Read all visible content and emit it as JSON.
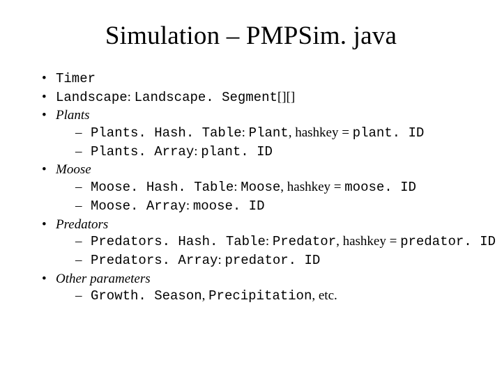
{
  "title": "Simulation – PMPSim. java",
  "bullets": {
    "b1": {
      "timer": "Timer"
    },
    "b2": {
      "landscape": "Landscape",
      "sep": ": ",
      "seg": "Landscape. Segment",
      "suffix": "[][]"
    },
    "b3": {
      "label": "Plants",
      "s1": {
        "a": "Plants. Hash. Table",
        "sep1": ": ",
        "b": "Plant",
        "mid": ", hashkey = ",
        "c": "plant. ID"
      },
      "s2": {
        "a": "Plants. Array",
        "sep1": ": ",
        "b": "plant. ID"
      }
    },
    "b4": {
      "label": "Moose",
      "s1": {
        "a": "Moose. Hash. Table",
        "sep1": ": ",
        "b": "Moose",
        "mid": ", hashkey = ",
        "c": "moose. ID"
      },
      "s2": {
        "a": "Moose. Array",
        "sep1": ": ",
        "b": "moose. ID"
      }
    },
    "b5": {
      "label": "Predators",
      "s1": {
        "a": "Predators. Hash. Table",
        "sep1": ": ",
        "b": "Predator",
        "mid": ", hashkey = ",
        "c": "predator. ID"
      },
      "s2": {
        "a": "Predators. Array",
        "sep1": ": ",
        "b": "predator. ID"
      }
    },
    "b6": {
      "label": "Other parameters",
      "s1": {
        "a": "Growth. Season",
        "sep": ", ",
        "b": "Precipitation",
        "suffix": ", etc."
      }
    }
  }
}
